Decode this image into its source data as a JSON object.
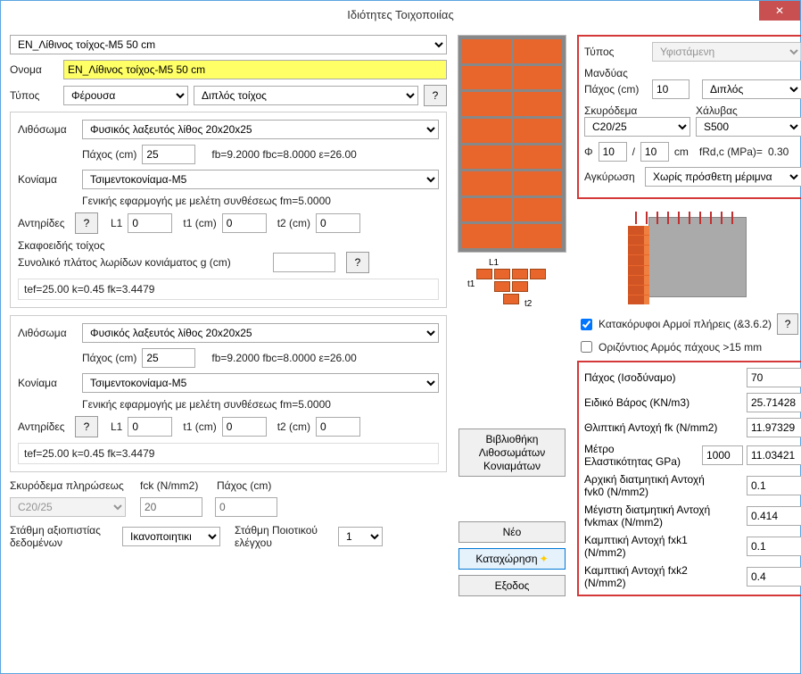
{
  "window": {
    "title": "Ιδιότητες Τοιχοποιίας",
    "close": "✕"
  },
  "topSelect": "EN_Λίθινος τοίχος-M5 50 cm",
  "nameLabel": "Ονομα",
  "nameValue": "EN_Λίθινος τοίχος-M5 50 cm",
  "typeLabel": "Τύπος",
  "typeValue": "Φέρουσα",
  "wallTypeValue": "Διπλός τοίχος",
  "help": "?",
  "block1": {
    "lithosomaLabel": "Λιθόσωμα",
    "lithosomaValue": "Φυσικός λαξευτός λίθος 20x20x25",
    "thicknessLabel": "Πάχος (cm)",
    "thicknessValue": "25",
    "fbText": "fb=9.2000 fbc=8.0000 ε=26.00",
    "koniamaLabel": "Κονίαμα",
    "koniamaValue": "Τσιμεντοκονίαμα-M5",
    "koniamaText": "Γενικής εφαρμογής με μελέτη συνθέσεως fm=5.0000",
    "antiridesLabel": "Αντηρίδες",
    "L1Label": "L1",
    "L1Value": "0",
    "t1Label": "t1 (cm)",
    "t1Value": "0",
    "t2Label": "t2 (cm)",
    "t2Value": "0",
    "skafLabel": "Σκαφοειδής τοίχος",
    "synolikoLabel": "Συνολικό πλάτος λωρίδων κονιάματος g (cm)",
    "synolikoValue": "",
    "tefText": "tef=25.00 k=0.45 fk=3.4479"
  },
  "block2": {
    "lithosomaLabel": "Λιθόσωμα",
    "lithosomaValue": "Φυσικός λαξευτός λίθος 20x20x25",
    "thicknessLabel": "Πάχος (cm)",
    "thicknessValue": "25",
    "fbText": "fb=9.2000 fbc=8.0000 ε=26.00",
    "koniamaLabel": "Κονίαμα",
    "koniamaValue": "Τσιμεντοκονίαμα-M5",
    "koniamaText": "Γενικής εφαρμογής με μελέτη συνθέσεως fm=5.0000",
    "antiridesLabel": "Αντηρίδες",
    "L1Label": "L1",
    "L1Value": "0",
    "t1Label": "t1 (cm)",
    "t1Value": "0",
    "t2Label": "t2 (cm)",
    "t2Value": "0",
    "tefText": "tef=25.00 k=0.45 fk=3.4479"
  },
  "fill": {
    "label": "Σκυρόδεμα πληρώσεως",
    "concreteValue": "C20/25",
    "fckLabel": "fck (N/mm2)",
    "fckValue": "20",
    "thicknessLabel": "Πάχος (cm)",
    "thicknessValue": "0"
  },
  "reliability": {
    "label1": "Στάθμη αξιοπιστίας",
    "label2": "δεδομένων",
    "value": "Ικανοποιητική",
    "qcLabel1": "Στάθμη Ποιοτικού",
    "qcLabel2": "ελέγχου",
    "qcValue": "1"
  },
  "buttons": {
    "library": "Βιβλιοθήκη Λιθοσωμάτων Κονιαμάτων",
    "new": "Νέο",
    "save": "Καταχώρηση",
    "exit": "Εξοδος"
  },
  "diagram": {
    "L1": "L1",
    "t1": "t1",
    "t2": "t2"
  },
  "jacket": {
    "typeLabel": "Τύπος",
    "typeValue": "Υφιστάμενη",
    "mandyasLabel": "Μανδύας",
    "thicknessLabel": "Πάχος (cm)",
    "thicknessValue": "10",
    "sidesValue": "Διπλός",
    "concreteLabel": "Σκυρόδεμα",
    "concreteValue": "C20/25",
    "steelLabel": "Χάλυβας",
    "steelValue": "S500",
    "phi": "Φ",
    "phi1": "10",
    "slash": "/",
    "phi2": "10",
    "cm": "cm",
    "frdLabel": "fRd,c (MPa)=",
    "frdValue": "0.30",
    "anchorLabel": "Αγκύρωση",
    "anchorValue": "Χωρίς πρόσθετη μέριμνα"
  },
  "joints": {
    "verticalLabel": "Κατακόρυφοι Αρμοί πλήρεις (&3.6.2)",
    "verticalChecked": true,
    "horizontalLabel": "Οριζόντιος Αρμός πάχους >15 mm",
    "horizontalChecked": false
  },
  "props": {
    "r1": {
      "label": "Πάχος (Ισοδύναμο)",
      "v": "70"
    },
    "r2": {
      "label": "Ειδικό Βάρος (KN/m3)",
      "v": "25.71428"
    },
    "r3": {
      "label": "Θλιπτική Αντοχή fk (N/mm2)",
      "v": "11.97329"
    },
    "r4": {
      "label1": "Μέτρο",
      "label2": "Ελαστικότητας GPa)",
      "v1": "1000",
      "v2": "11.03421"
    },
    "r5": {
      "label1": "Αρχική διατμητική Αντοχή",
      "label2": "fvk0 (N/mm2)",
      "v": "0.1"
    },
    "r6": {
      "label1": "Μέγιστη διατμητική Αντοχή",
      "label2": "fvkmax (N/mm2)",
      "v": "0.414"
    },
    "r7": {
      "label1": "Καμπτική Αντοχή  fxk1",
      "label2": "(N/mm2)",
      "v": "0.1"
    },
    "r8": {
      "label1": "Καμπτική Αντοχή  fxk2",
      "label2": "(N/mm2)",
      "v": "0.4"
    }
  }
}
